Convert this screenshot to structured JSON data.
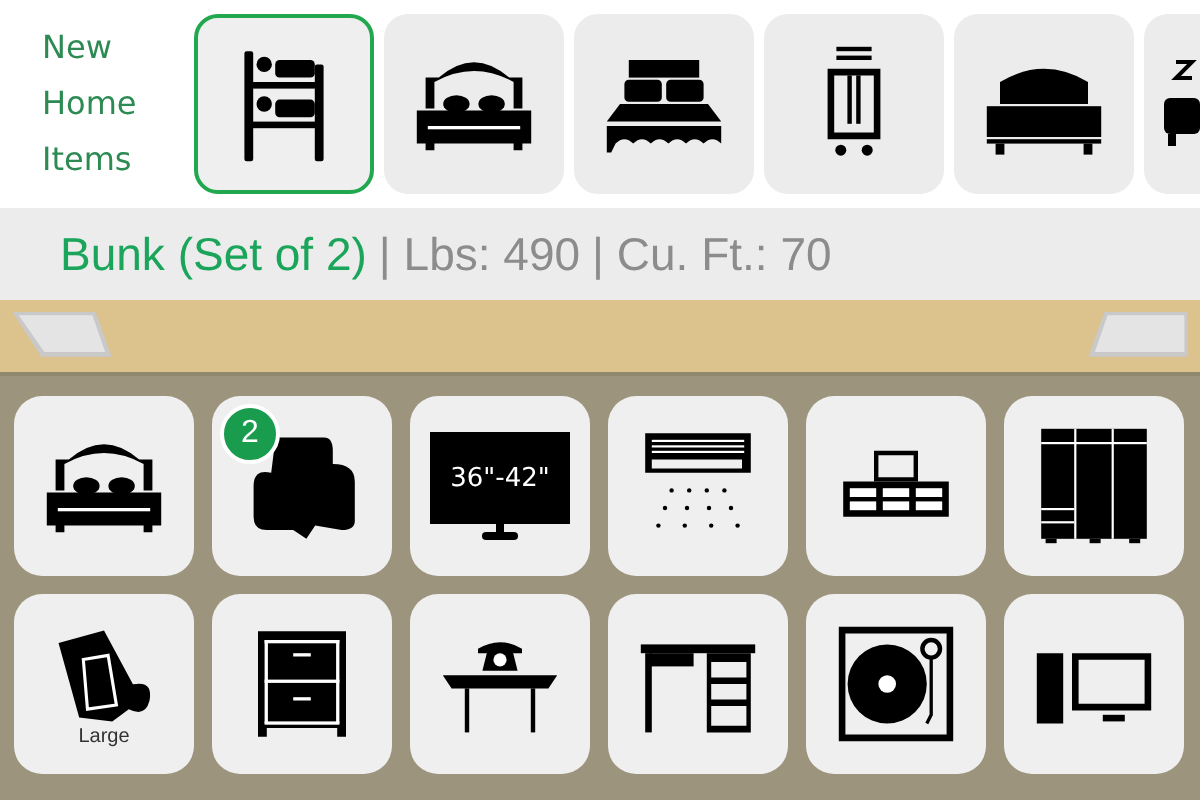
{
  "header": {
    "label_lines": [
      "New",
      "Home",
      "Items"
    ]
  },
  "carousel": [
    {
      "kind": "bunk-bed",
      "selected": true
    },
    {
      "kind": "double-bed",
      "selected": false
    },
    {
      "kind": "skirted-bed",
      "selected": false
    },
    {
      "kind": "luggage-cart",
      "selected": false
    },
    {
      "kind": "plain-bed",
      "selected": false
    },
    {
      "kind": "sleeping-bed",
      "selected": false
    }
  ],
  "info": {
    "name": "Bunk (Set of 2)",
    "weight": "| Lbs: 490",
    "volume": "| Cu. Ft.: 70"
  },
  "grid": [
    {
      "kind": "double-bed"
    },
    {
      "kind": "armchair",
      "badge": "2"
    },
    {
      "kind": "tv",
      "label": "36\"-42\""
    },
    {
      "kind": "air-conditioner"
    },
    {
      "kind": "tv-stand"
    },
    {
      "kind": "wardrobe"
    },
    {
      "kind": "rug",
      "label": "Large"
    },
    {
      "kind": "nightstand"
    },
    {
      "kind": "phone-table"
    },
    {
      "kind": "desk"
    },
    {
      "kind": "turntable"
    },
    {
      "kind": "computer"
    }
  ]
}
